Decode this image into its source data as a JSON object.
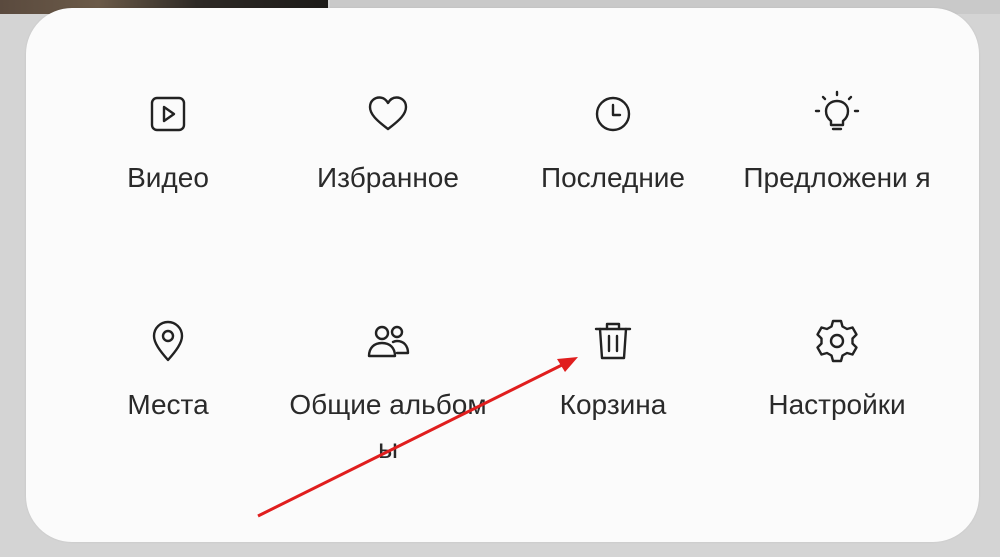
{
  "menu": {
    "items": [
      {
        "label": "Видео",
        "icon": "video-icon"
      },
      {
        "label": "Избранное",
        "icon": "heart-icon"
      },
      {
        "label": "Последние",
        "icon": "clock-icon"
      },
      {
        "label": "Предложени я",
        "icon": "lightbulb-icon"
      },
      {
        "label": "Места",
        "icon": "location-pin-icon"
      },
      {
        "label": "Общие альбомы",
        "icon": "people-icon"
      },
      {
        "label": "Корзина",
        "icon": "trash-icon"
      },
      {
        "label": "Настройки",
        "icon": "gear-icon"
      }
    ]
  },
  "annotation": {
    "arrow_color": "#e01e1e",
    "points_to": "Корзина"
  }
}
